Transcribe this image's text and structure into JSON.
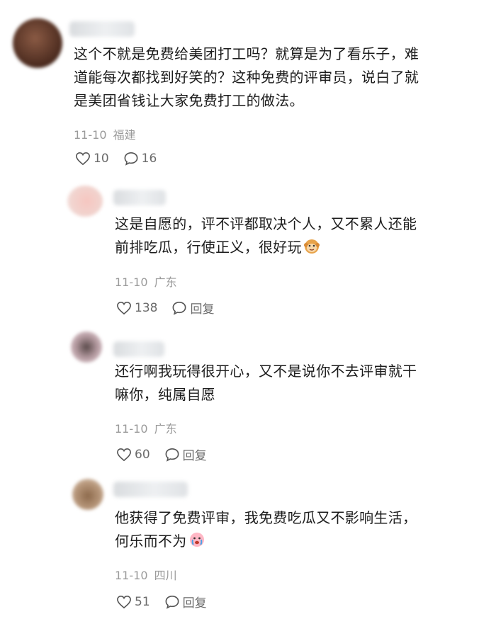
{
  "comments": [
    {
      "lines": [
        "这个不就是免费给美团打工吗？就算是为了看乐子，难",
        "道能每次都找到好笑的？这种免费的评审员，说白了就",
        "是美团省钱让大家免费打工的做法。"
      ],
      "date": "11-10",
      "location": "福建",
      "likes": "10",
      "replies": "16"
    },
    {
      "lines": [
        "这是自愿的，评不评都取决个人，又不累人还能",
        "前排吃瓜，行使正义，很好玩"
      ],
      "emoji": "monkey-emoji",
      "date": "11-10",
      "location": "广东",
      "likes": "138",
      "reply_label": "回复"
    },
    {
      "lines": [
        "还行啊我玩得很开心，又不是说你不去评审就干",
        "嘛你，纯属自愿"
      ],
      "date": "11-10",
      "location": "广东",
      "likes": "60",
      "reply_label": "回复"
    },
    {
      "lines": [
        "他获得了免费评审，我免费吃瓜又不影响生活，",
        "何乐而不为"
      ],
      "emoji": "crying-face-emoji",
      "date": "11-10",
      "location": "四川",
      "likes": "51",
      "reply_label": "回复"
    }
  ]
}
